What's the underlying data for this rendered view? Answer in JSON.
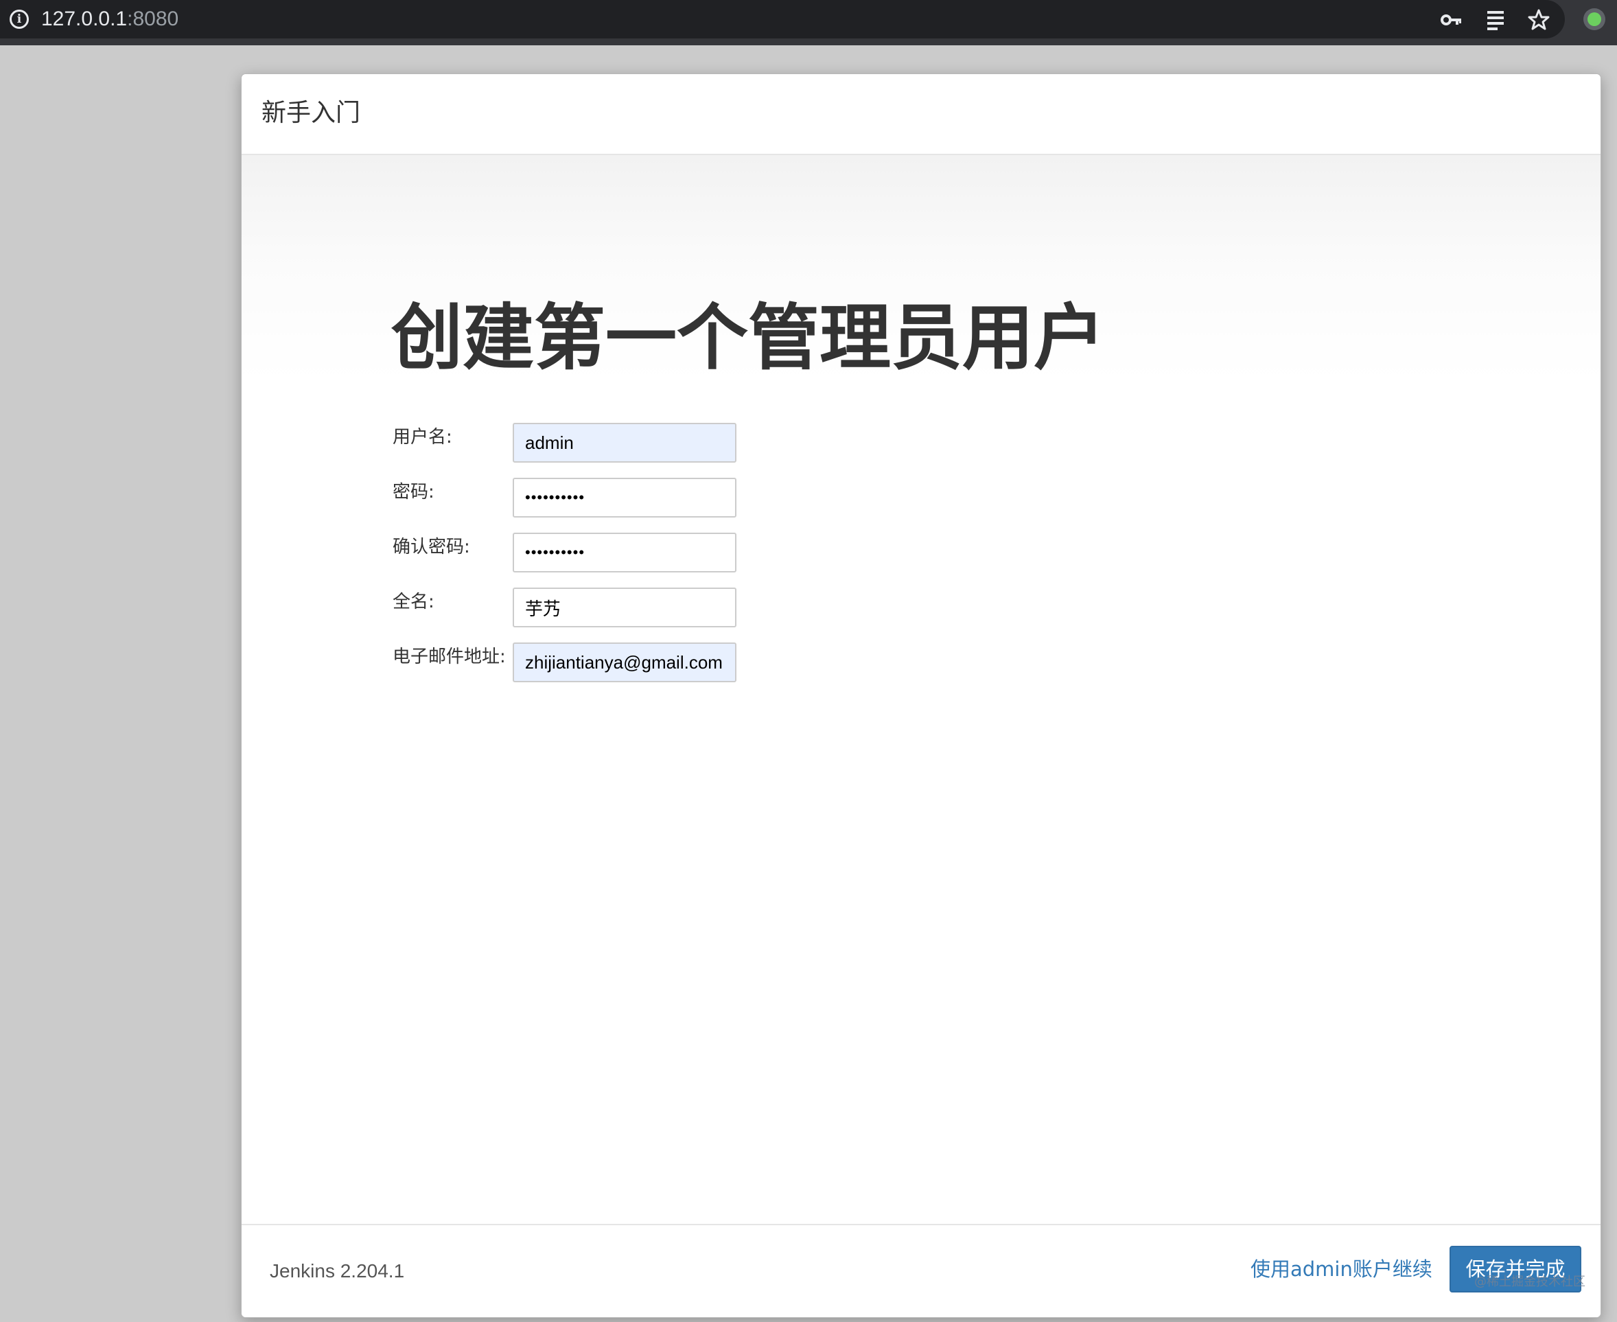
{
  "browser": {
    "url_host": "127.0.0.1",
    "url_port": ":8080",
    "icons": [
      "info-icon",
      "key-icon",
      "reader-icon",
      "star-icon",
      "profile-icon"
    ],
    "colors": {
      "toolbar": "#35363a",
      "omnibox": "#202124",
      "profile": "#6ccf5f"
    }
  },
  "dialog": {
    "title": "新手入门",
    "heading": "创建第一个管理员用户",
    "form": {
      "username": {
        "label": "用户名:",
        "value": "admin"
      },
      "password": {
        "label": "密码:",
        "value": "••••••••••"
      },
      "confirm_password": {
        "label": "确认密码:",
        "value": "••••••••••"
      },
      "full_name": {
        "label": "全名:",
        "value": "芋艿"
      },
      "email": {
        "label": "电子邮件地址:",
        "value": "zhijiantianya@gmail.com"
      }
    },
    "footer": {
      "version": "Jenkins 2.204.1",
      "continue_as_admin": "使用admin账户继续",
      "save_and_finish": "保存并完成"
    },
    "colors": {
      "primary": "#337ab7",
      "autofill": "#e8f0fe"
    }
  },
  "watermark": "@稀土掘金技术社区"
}
